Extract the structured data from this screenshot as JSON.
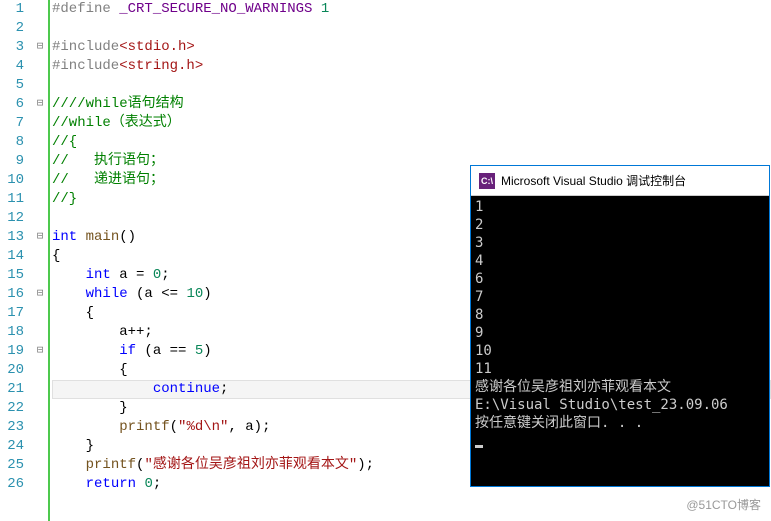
{
  "lines": [
    {
      "num": "1",
      "fold": "",
      "tokens": [
        [
          "pp",
          "#define "
        ],
        [
          "mac",
          "_CRT_SECURE_NO_WARNINGS"
        ],
        [
          "txt",
          " "
        ],
        [
          "num",
          "1"
        ]
      ]
    },
    {
      "num": "2",
      "fold": "",
      "tokens": []
    },
    {
      "num": "3",
      "fold": "⊟",
      "tokens": [
        [
          "pp",
          "#include"
        ],
        [
          "str",
          "<stdio.h>"
        ]
      ]
    },
    {
      "num": "4",
      "fold": "",
      "tokens": [
        [
          "pp",
          "#include"
        ],
        [
          "str",
          "<string.h>"
        ]
      ]
    },
    {
      "num": "5",
      "fold": "",
      "tokens": []
    },
    {
      "num": "6",
      "fold": "⊟",
      "tokens": [
        [
          "cmt",
          "////while语句结构"
        ]
      ]
    },
    {
      "num": "7",
      "fold": "",
      "tokens": [
        [
          "cmt",
          "//while（表达式）"
        ]
      ]
    },
    {
      "num": "8",
      "fold": "",
      "tokens": [
        [
          "cmt",
          "//{"
        ]
      ]
    },
    {
      "num": "9",
      "fold": "",
      "tokens": [
        [
          "cmt",
          "//   执行语句；"
        ]
      ]
    },
    {
      "num": "10",
      "fold": "",
      "tokens": [
        [
          "cmt",
          "//   递进语句；"
        ]
      ]
    },
    {
      "num": "11",
      "fold": "",
      "tokens": [
        [
          "cmt",
          "//}"
        ]
      ]
    },
    {
      "num": "12",
      "fold": "",
      "tokens": []
    },
    {
      "num": "13",
      "fold": "⊟",
      "tokens": [
        [
          "kw",
          "int"
        ],
        [
          "txt",
          " "
        ],
        [
          "fn",
          "main"
        ],
        [
          "txt",
          "()"
        ]
      ]
    },
    {
      "num": "14",
      "fold": "",
      "tokens": [
        [
          "txt",
          "{"
        ]
      ]
    },
    {
      "num": "15",
      "fold": "",
      "tokens": [
        [
          "txt",
          "    "
        ],
        [
          "kw",
          "int"
        ],
        [
          "txt",
          " a = "
        ],
        [
          "num",
          "0"
        ],
        [
          "txt",
          ";"
        ]
      ]
    },
    {
      "num": "16",
      "fold": "⊟",
      "tokens": [
        [
          "txt",
          "    "
        ],
        [
          "kw",
          "while"
        ],
        [
          "txt",
          " (a <= "
        ],
        [
          "num",
          "10"
        ],
        [
          "txt",
          ")"
        ]
      ]
    },
    {
      "num": "17",
      "fold": "",
      "tokens": [
        [
          "txt",
          "    {"
        ]
      ]
    },
    {
      "num": "18",
      "fold": "",
      "tokens": [
        [
          "txt",
          "        a++;"
        ]
      ]
    },
    {
      "num": "19",
      "fold": "⊟",
      "tokens": [
        [
          "txt",
          "        "
        ],
        [
          "kw",
          "if"
        ],
        [
          "txt",
          " (a == "
        ],
        [
          "num",
          "5"
        ],
        [
          "txt",
          ")"
        ]
      ]
    },
    {
      "num": "20",
      "fold": "",
      "tokens": [
        [
          "txt",
          "        {"
        ]
      ]
    },
    {
      "num": "21",
      "fold": "",
      "hl": true,
      "tokens": [
        [
          "txt",
          "            "
        ],
        [
          "kw",
          "continue"
        ],
        [
          "txt",
          ";"
        ]
      ]
    },
    {
      "num": "22",
      "fold": "",
      "tokens": [
        [
          "txt",
          "        }"
        ]
      ]
    },
    {
      "num": "23",
      "fold": "",
      "tokens": [
        [
          "txt",
          "        "
        ],
        [
          "fn",
          "printf"
        ],
        [
          "txt",
          "("
        ],
        [
          "str",
          "\"%d\\n\""
        ],
        [
          "txt",
          ", a);"
        ]
      ]
    },
    {
      "num": "24",
      "fold": "",
      "tokens": [
        [
          "txt",
          "    }"
        ]
      ]
    },
    {
      "num": "25",
      "fold": "",
      "tokens": [
        [
          "txt",
          "    "
        ],
        [
          "fn",
          "printf"
        ],
        [
          "txt",
          "("
        ],
        [
          "str",
          "\"感谢各位吴彦祖刘亦菲观看本文\""
        ],
        [
          "txt",
          ");"
        ]
      ]
    },
    {
      "num": "26",
      "fold": "",
      "tokens": [
        [
          "txt",
          "    "
        ],
        [
          "kw",
          "return"
        ],
        [
          "txt",
          " "
        ],
        [
          "num",
          "0"
        ],
        [
          "txt",
          ";"
        ]
      ]
    }
  ],
  "console": {
    "title": "Microsoft Visual Studio 调试控制台",
    "icon_text": "C:\\",
    "output": "1\n2\n3\n4\n6\n7\n8\n9\n10\n11\n感谢各位吴彦祖刘亦菲观看本文\nE:\\Visual Studio\\test_23.09.06\n按任意键关闭此窗口. . ."
  },
  "watermark": "@51CTO博客"
}
